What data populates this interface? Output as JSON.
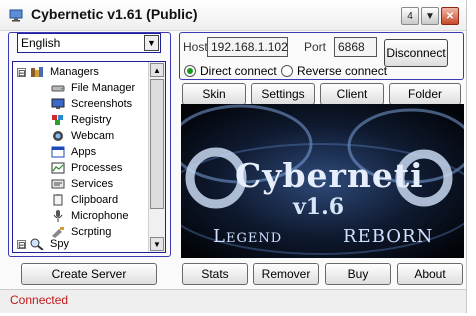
{
  "window": {
    "title": "Cybernetic v1.61 (Public)"
  },
  "titlebar_buttons": {
    "left": "4",
    "minimize": "▼",
    "close": "✕"
  },
  "language": {
    "selected": "English"
  },
  "tree": {
    "items": [
      {
        "label": "Managers",
        "expander": "⊟",
        "icon": "managers-icon"
      },
      {
        "label": "File Manager",
        "icon": "drive-icon"
      },
      {
        "label": "Screenshots",
        "icon": "monitor-icon"
      },
      {
        "label": "Registry",
        "icon": "registry-icon"
      },
      {
        "label": "Webcam",
        "icon": "webcam-icon"
      },
      {
        "label": "Apps",
        "icon": "apps-icon"
      },
      {
        "label": "Processes",
        "icon": "processes-icon"
      },
      {
        "label": "Services",
        "icon": "services-icon"
      },
      {
        "label": "Clipboard",
        "icon": "clipboard-icon"
      },
      {
        "label": "Microphone",
        "icon": "microphone-icon"
      },
      {
        "label": "Scrpting",
        "icon": "scripting-icon"
      },
      {
        "label": "Spy",
        "expander": "⊟",
        "icon": "spy-icon"
      }
    ]
  },
  "connection": {
    "host_label": "Host",
    "host_value": "192.168.1.102",
    "port_label": "Port",
    "port_value": "6868",
    "disconnect_label": "Disconnect",
    "direct_label": "Direct connect",
    "reverse_label": "Reverse connect",
    "mode": "direct"
  },
  "tabs": [
    "Skin",
    "Settings",
    "Client",
    "Folder"
  ],
  "banner": {
    "name": "Cyberneti",
    "version": "v1.6",
    "left": "Legend",
    "right": "reborn"
  },
  "create_server_label": "Create Server",
  "bottom_buttons": [
    "Stats",
    "Remover",
    "Buy",
    "About"
  ],
  "status": {
    "text": "Connected",
    "color": "#c01818"
  }
}
